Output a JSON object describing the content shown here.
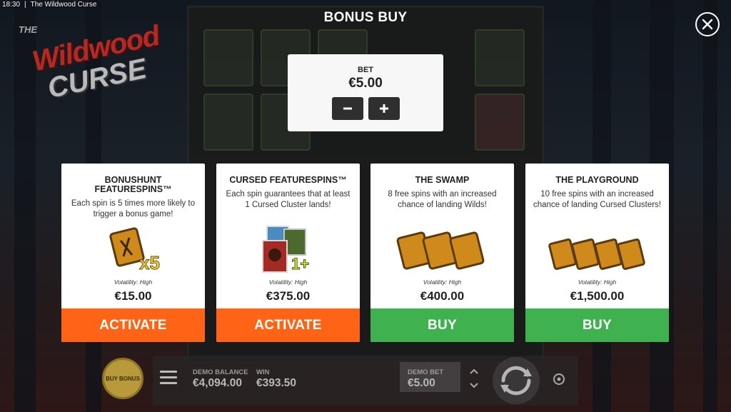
{
  "window": {
    "time": "18:30",
    "separator": "|",
    "title": "The Wildwood Curse"
  },
  "logo": {
    "the": "THE",
    "wild": "Wildwood",
    "curse": "CURSE"
  },
  "page_title": "BONUS BUY",
  "bet_panel": {
    "label": "BET",
    "value": "€5.00",
    "minus": "−",
    "plus": "+"
  },
  "cards": [
    {
      "title": "BONUSHUNT FEATURESPINS™",
      "description": "Each spin is 5 times more likely to trigger a bonus game!",
      "art_badge": "x5",
      "volatility": "Volatility: High",
      "price": "€15.00",
      "button": "ACTIVATE"
    },
    {
      "title": "CURSED FEATURESPINS™",
      "description": "Each spin guarantees that at least 1 Cursed Cluster lands!",
      "art_badge": "1+",
      "volatility": "Volatility: High",
      "price": "€375.00",
      "button": "ACTIVATE"
    },
    {
      "title": "THE SWAMP",
      "description": "8 free spins with an increased chance of landing Wilds!",
      "volatility": "Volatility: High",
      "price": "€400.00",
      "button": "BUY"
    },
    {
      "title": "THE PLAYGROUND",
      "description": "10 free spins with an increased chance of landing Cursed Clusters!",
      "volatility": "Volatility: High",
      "price": "€1,500.00",
      "button": "BUY"
    }
  ],
  "bottom_bar": {
    "buy_bonus": "BUY BONUS",
    "demo_balance_label": "DEMO BALANCE",
    "demo_balance_value": "€4,094.00",
    "win_label": "WIN",
    "win_value": "€393.50",
    "demo_bet_label": "DEMO BET",
    "demo_bet_value": "€5.00"
  },
  "colors": {
    "activate": "#ff6416",
    "buy": "#3fb24f",
    "card_bg": "#ffffff"
  }
}
